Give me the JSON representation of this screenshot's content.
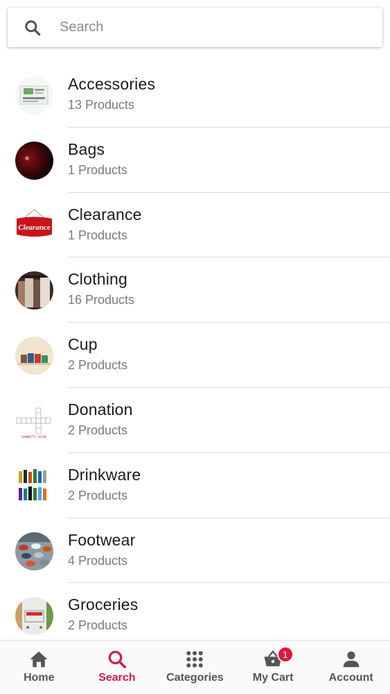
{
  "search": {
    "placeholder": "Search"
  },
  "categories": [
    {
      "name": "Accessories",
      "count": "13 Products",
      "thumb": "accessories-thumbnail"
    },
    {
      "name": "Bags",
      "count": "1 Products",
      "thumb": "bags-thumbnail"
    },
    {
      "name": "Clearance",
      "count": "1 Products",
      "thumb": "clearance-thumbnail"
    },
    {
      "name": "Clothing",
      "count": "16 Products",
      "thumb": "clothing-thumbnail"
    },
    {
      "name": "Cup",
      "count": "2 Products",
      "thumb": "cup-thumbnail"
    },
    {
      "name": "Donation",
      "count": "2 Products",
      "thumb": "donation-thumbnail"
    },
    {
      "name": "Drinkware",
      "count": "2 Products",
      "thumb": "drinkware-thumbnail"
    },
    {
      "name": "Footwear",
      "count": "4 Products",
      "thumb": "footwear-thumbnail"
    },
    {
      "name": "Groceries",
      "count": "2 Products",
      "thumb": "groceries-thumbnail"
    }
  ],
  "thumb_text": {
    "clearance": "Clearance",
    "donation": "CHARITY GIVE"
  },
  "nav": {
    "items": [
      {
        "label": "Home",
        "icon": "home-icon"
      },
      {
        "label": "Search",
        "icon": "search-icon"
      },
      {
        "label": "Categories",
        "icon": "grid-icon"
      },
      {
        "label": "My Cart",
        "icon": "basket-icon"
      },
      {
        "label": "Account",
        "icon": "person-icon"
      }
    ],
    "active": "Search",
    "cart_badge": "1"
  },
  "colors": {
    "accent": "#d81b46",
    "badge": "#e4163a",
    "nav_text": "#555555"
  }
}
